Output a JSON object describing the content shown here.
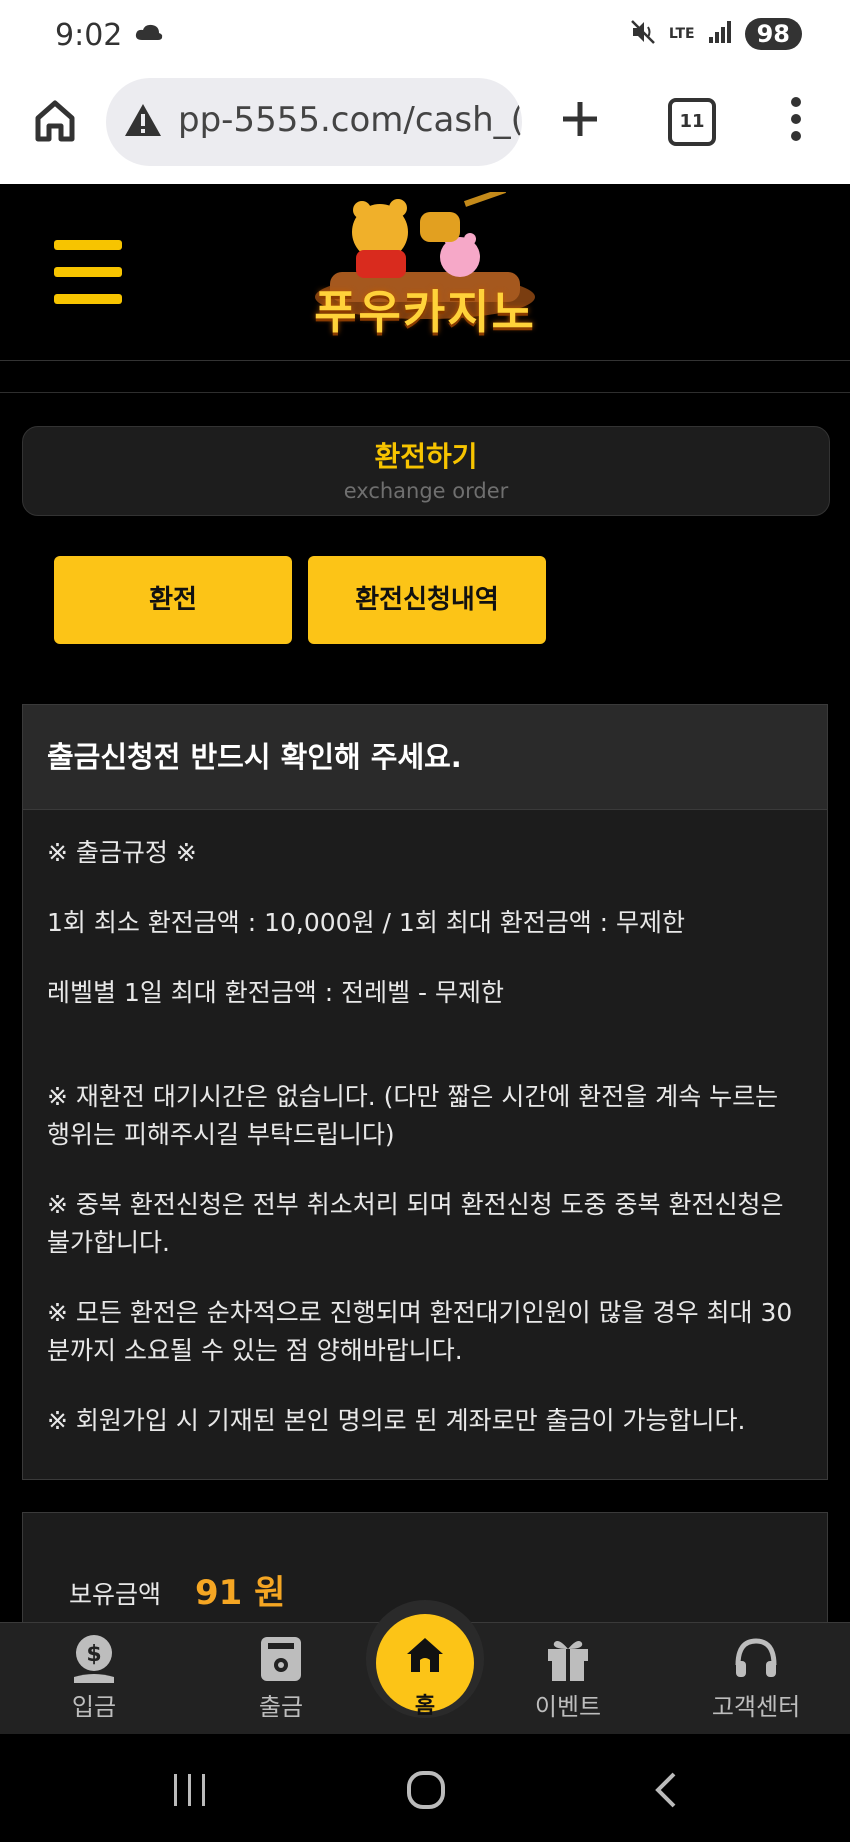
{
  "status_bar": {
    "time": "9:02",
    "network": "LTE",
    "battery": "98"
  },
  "browser": {
    "url": "pp-5555.com/cash_(",
    "tab_count": "11"
  },
  "site": {
    "logo_text": "푸우카지노"
  },
  "title": {
    "korean": "환전하기",
    "english": "exchange order"
  },
  "buttons": {
    "exchange": "환전",
    "history": "환전신청내역"
  },
  "notice": {
    "heading": "출금신청전 반드시 확인해 주세요.",
    "rules_title": "※ 출금규정 ※",
    "line_min_max": "1회 최소 환전금액 : 10,000원 / 1회 최대 환전금액 : 무제한",
    "line_daily": "레벨별 1일 최대 환전금액 : 전레벨 - 무제한",
    "line_wait": "※ 재환전 대기시간은 없습니다. (다만 짧은 시간에 환전을 계속 누르는 행위는 피해주시길 부탁드립니다)",
    "line_duplicate": "※ 중복 환전신청은 전부 취소처리 되며 환전신청 도중 중복 환전신청은 불가합니다.",
    "line_order": "※ 모든 환전은 순차적으로 진행되며 환전대기인원이 많을 경우 최대 30분까지 소요될 수 있는 점 양해바랍니다.",
    "line_account": "※ 회원가입 시 기재된 본인 명의로 된 계좌로만 출금이 가능합니다."
  },
  "balance": {
    "label": "보유금액",
    "value": "91 원"
  },
  "bottom_nav": {
    "deposit": "입금",
    "withdraw": "출금",
    "home": "홈",
    "event": "이벤트",
    "support": "고객센터"
  },
  "colors": {
    "accent": "#fcc417",
    "balance": "#f5a623",
    "panel": "#1c1c1c"
  }
}
